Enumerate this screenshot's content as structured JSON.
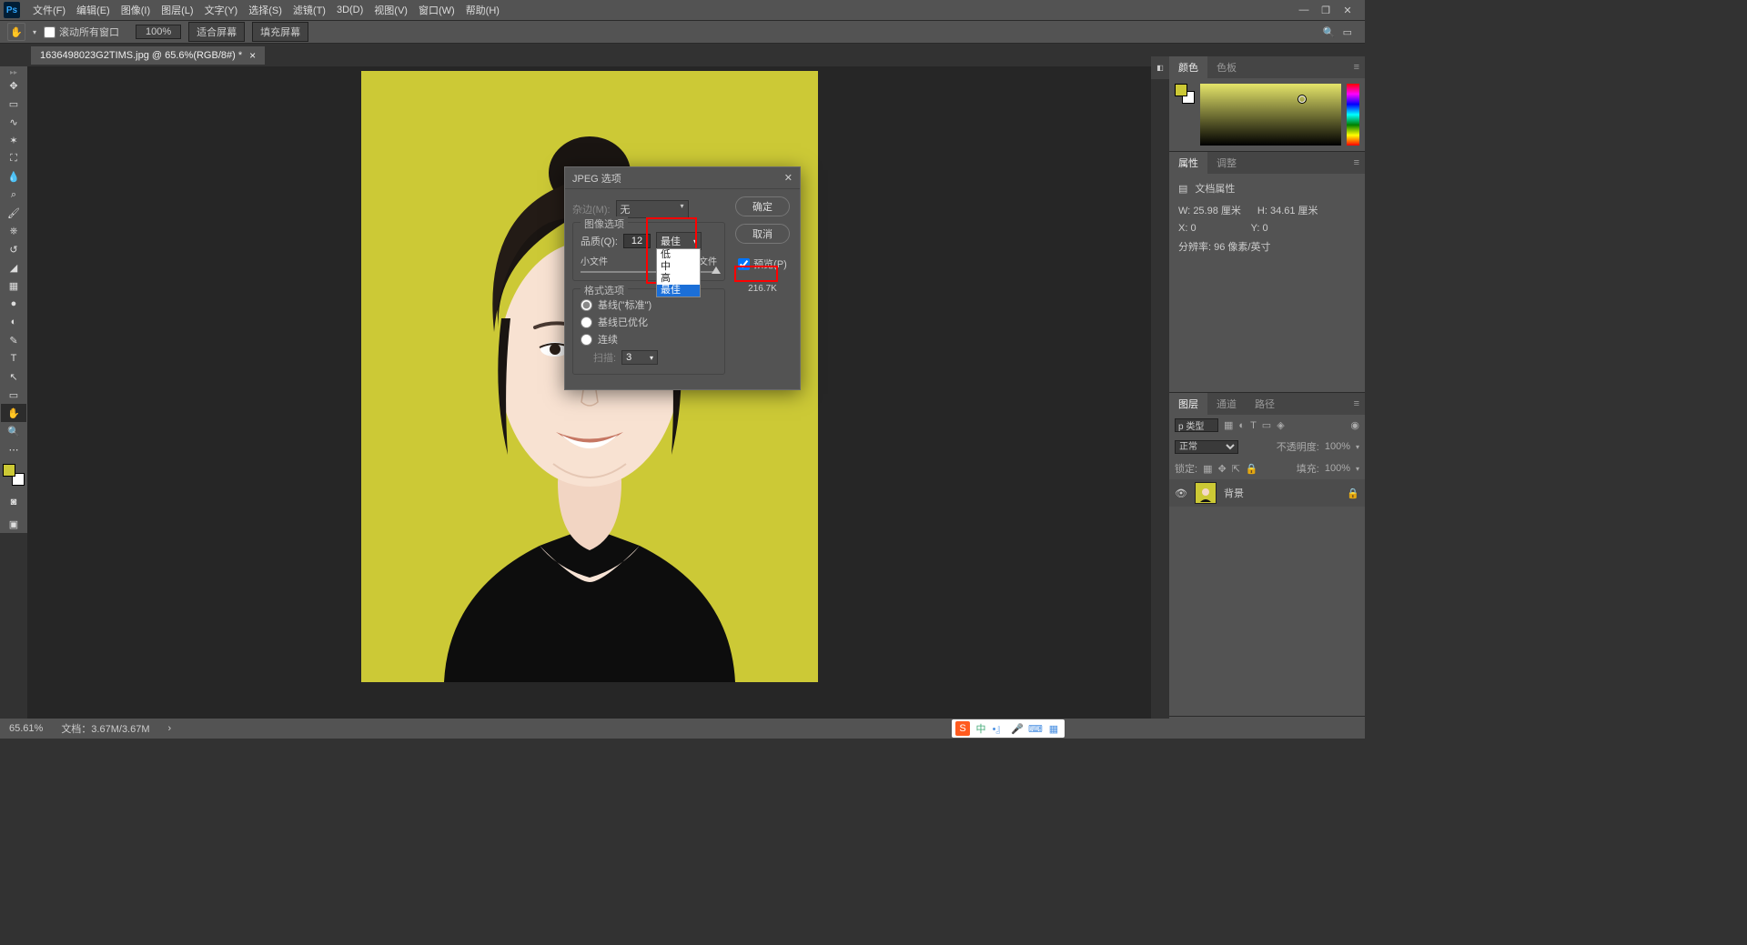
{
  "menubar": {
    "logo": "Ps",
    "items": [
      "文件(F)",
      "编辑(E)",
      "图像(I)",
      "图层(L)",
      "文字(Y)",
      "选择(S)",
      "滤镜(T)",
      "3D(D)",
      "视图(V)",
      "窗口(W)",
      "帮助(H)"
    ]
  },
  "optionsbar": {
    "scroll_all": "滚动所有窗口",
    "zoom": "100%",
    "fit": "适合屏幕",
    "fill": "填充屏幕"
  },
  "doctab": {
    "label": "1636498023G2TIMS.jpg @ 65.6%(RGB/8#) *"
  },
  "dialog": {
    "title": "JPEG 选项",
    "ok": "确定",
    "cancel": "取消",
    "matte_label": "杂边(M):",
    "matte_value": "无",
    "image_options_title": "图像选项",
    "quality_label": "品质(Q):",
    "quality_value": "12",
    "quality_preset": "最佳",
    "presets": [
      "低",
      "中",
      "高",
      "最佳"
    ],
    "small_file": "小文件",
    "large_file": "大文件",
    "format_options_title": "格式选项",
    "baseline": "基线(\"标准\")",
    "baseline_opt": "基线已优化",
    "progressive": "连续",
    "scans_label": "扫描:",
    "scans_value": "3",
    "preview_label": "预览(P)",
    "filesize": "216.7K"
  },
  "panels": {
    "color_tab": "颜色",
    "swatches_tab": "色板",
    "props_tab": "属性",
    "adjust_tab": "调整",
    "doc_props": "文档属性",
    "w_label": "W:",
    "w_value": "25.98 厘米",
    "h_label": "H:",
    "h_value": "34.61 厘米",
    "x_label": "X:",
    "x_value": "0",
    "y_label": "Y:",
    "y_value": "0",
    "res_label": "分辨率: 96 像素/英寸",
    "layers_tab": "图层",
    "channels_tab": "通道",
    "paths_tab": "路径",
    "filter_kind": "p 类型",
    "blend_mode": "正常",
    "opacity_label": "不透明度:",
    "opacity_value": "100%",
    "lock_label": "锁定:",
    "fill_label": "填充:",
    "fill_value": "100%",
    "layer_name": "背景"
  },
  "statusbar": {
    "zoom": "65.61%",
    "doc_size": "文档：3.67M/3.67M"
  },
  "ime": {
    "s": "S",
    "zh": "中"
  }
}
